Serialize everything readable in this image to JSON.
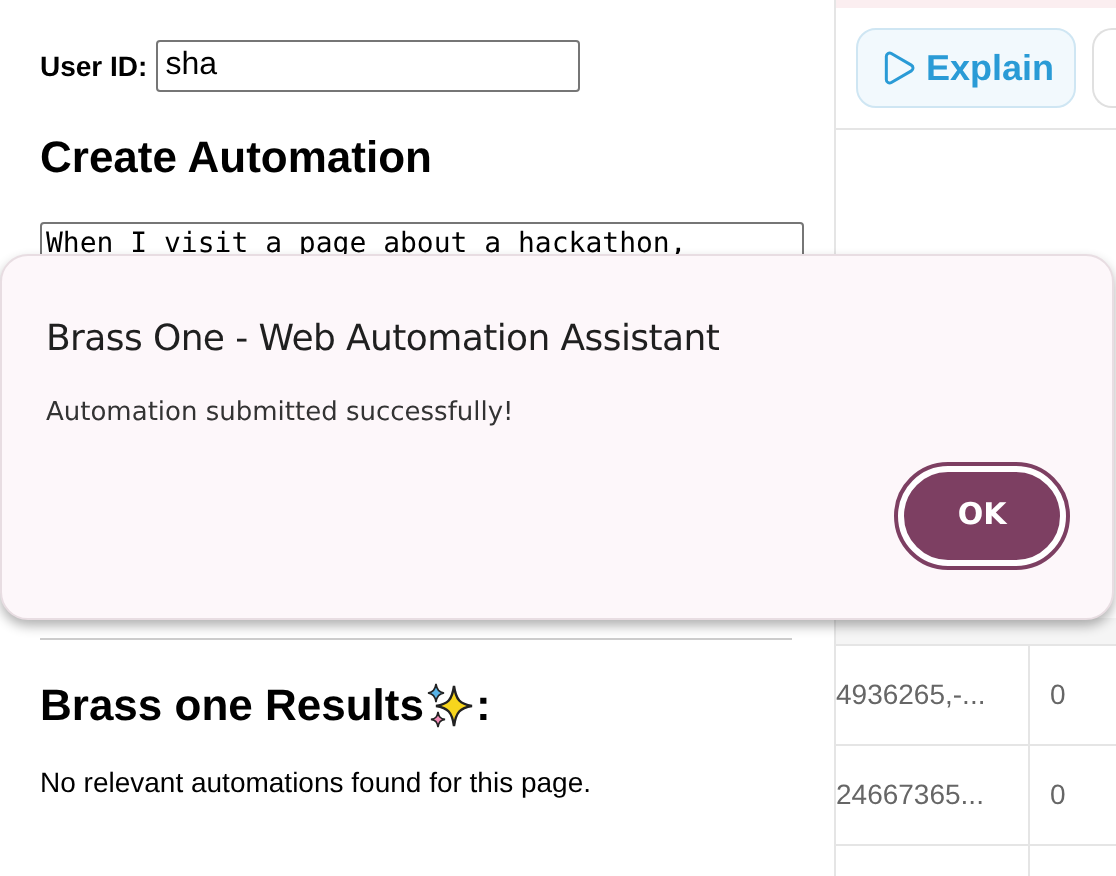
{
  "user_id": {
    "label": "User ID:",
    "value": "sha"
  },
  "create": {
    "heading": "Create Automation",
    "prompt": "When I visit a page about a hackathon,"
  },
  "results": {
    "heading": "Brass one Results",
    "suffix": ":",
    "message": "No relevant automations found for this page."
  },
  "toolbar": {
    "explain_button": {
      "label": "Explain"
    }
  },
  "table": {
    "rows": [
      [
        "4936265,-...",
        "0"
      ],
      [
        "24667365...",
        "0"
      ]
    ]
  },
  "dialog": {
    "title": "Brass One - Web Automation Assistant",
    "message": "Automation submitted successfully!",
    "button": "OK"
  }
}
